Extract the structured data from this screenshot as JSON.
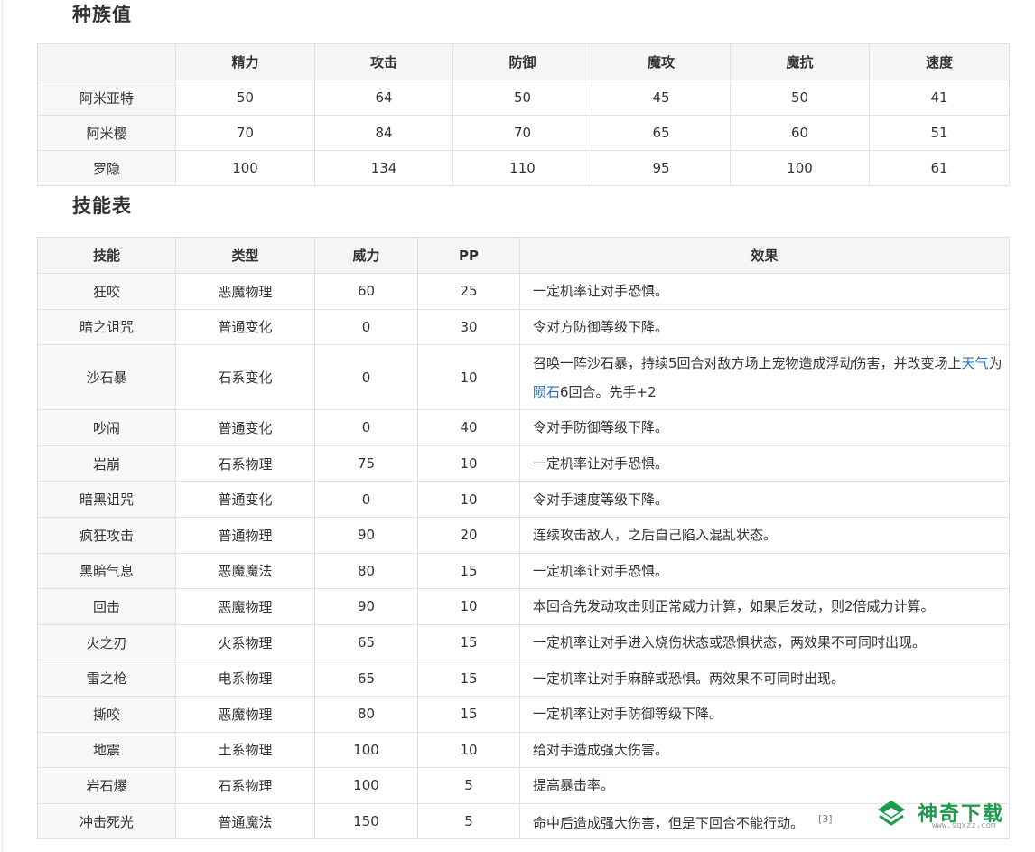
{
  "stats_section": {
    "title": "种族值",
    "headers": [
      "",
      "精力",
      "攻击",
      "防御",
      "魔攻",
      "魔抗",
      "速度"
    ],
    "rows": [
      [
        "阿米亚特",
        "50",
        "64",
        "50",
        "45",
        "50",
        "41"
      ],
      [
        "阿米樱",
        "70",
        "84",
        "70",
        "65",
        "60",
        "51"
      ],
      [
        "罗隐",
        "100",
        "134",
        "110",
        "95",
        "100",
        "61"
      ]
    ]
  },
  "skills_section": {
    "title": "技能表",
    "headers": [
      "技能",
      "类型",
      "威力",
      "PP",
      "效果"
    ],
    "rows": [
      [
        "狂咬",
        "恶魔物理",
        "60",
        "25",
        "一定机率让对手恐惧。"
      ],
      [
        "暗之诅咒",
        "普通变化",
        "0",
        "30",
        "令对方防御等级下降。"
      ],
      [
        "沙石暴",
        "石系变化",
        "0",
        "10",
        ""
      ],
      [
        "吵闹",
        "普通变化",
        "0",
        "40",
        "令对手防御等级下降。"
      ],
      [
        "岩崩",
        "石系物理",
        "75",
        "10",
        "一定机率让对手恐惧。"
      ],
      [
        "暗黑诅咒",
        "普通变化",
        "0",
        "10",
        "令对手速度等级下降。"
      ],
      [
        "疯狂攻击",
        "普通物理",
        "90",
        "20",
        "连续攻击敌人，之后自己陷入混乱状态。"
      ],
      [
        "黑暗气息",
        "恶魔魔法",
        "80",
        "15",
        "一定机率让对手恐惧。"
      ],
      [
        "回击",
        "恶魔物理",
        "90",
        "10",
        "本回合先发动攻击则正常威力计算，如果后发动，则2倍威力计算。"
      ],
      [
        "火之刃",
        "火系物理",
        "65",
        "15",
        "一定机率让对手进入烧伤状态或恐惧状态，两效果不可同时出现。"
      ],
      [
        "雷之枪",
        "电系物理",
        "65",
        "15",
        "一定机率让对手麻醉或恐惧。两效果不可同时出现。"
      ],
      [
        "撕咬",
        "恶魔物理",
        "80",
        "15",
        "一定机率让对手防御等级下降。"
      ],
      [
        "地震",
        "土系物理",
        "100",
        "10",
        "给对手造成强大伤害。"
      ],
      [
        "岩石爆",
        "石系物理",
        "100",
        "5",
        "提高暴击率。"
      ],
      [
        "冲击死光",
        "普通魔法",
        "150",
        "5",
        "命中后造成强大伤害，但是下回合不能行动。"
      ]
    ],
    "sandstorm_effect": {
      "part1": "召唤一阵沙石暴，持续5回合对敌方场上宠物造成浮动伤害，并改变场上",
      "link_weather": "天气",
      "part2": "为",
      "link_meteor": "陨石",
      "part3": "6回合。先手+2"
    },
    "citation": "[3]"
  },
  "watermark": {
    "title": "神奇下载",
    "url": "www.sqxzz.com",
    "color": "#1f9a4c"
  }
}
